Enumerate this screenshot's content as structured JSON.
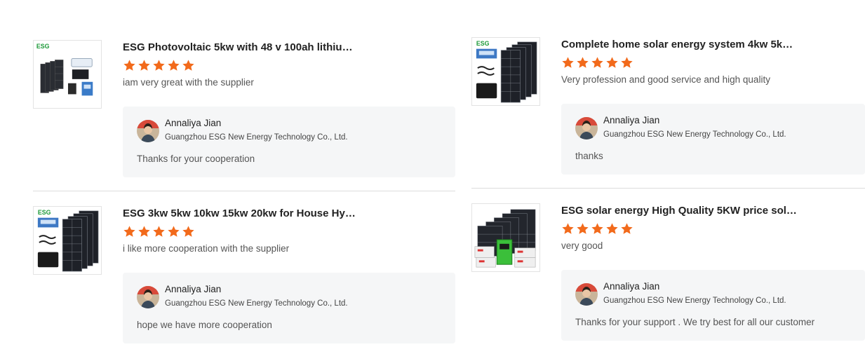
{
  "star_color": "#f26a1b",
  "reviews": [
    {
      "title": "ESG Photovoltaic 5kw with 48 v 100ah lithium ...",
      "stars": 5,
      "comment": "iam very great with the supplier",
      "reply": {
        "name": "Annaliya Jian",
        "company": "Guangzhou ESG New Energy Technology Co., Ltd.",
        "text": "Thanks for your cooperation"
      }
    },
    {
      "title": "Complete home solar energy system 4kw 5kw ...",
      "stars": 5,
      "comment": "Very profession and good service and high quality",
      "reply": {
        "name": "Annaliya Jian",
        "company": "Guangzhou ESG New Energy Technology Co., Ltd.",
        "text": "thanks"
      }
    },
    {
      "title": "ESG 3kw 5kw 10kw 15kw 20kw for House Hybr...",
      "stars": 5,
      "comment": "i like more cooperation with the supplier",
      "reply": {
        "name": "Annaliya Jian",
        "company": "Guangzhou ESG New Energy Technology Co., Ltd.",
        "text": "hope we have more cooperation"
      }
    },
    {
      "title": "ESG solar energy High Quality 5KW price solar ...",
      "stars": 5,
      "comment": "very good",
      "reply": {
        "name": "Annaliya Jian",
        "company": "Guangzhou ESG New Energy Technology Co., Ltd.",
        "text": "Thanks for your support . We try best for all our customer"
      }
    }
  ]
}
